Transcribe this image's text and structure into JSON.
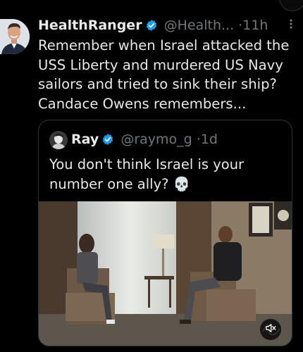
{
  "tweet": {
    "display_name": "HealthRanger",
    "handle": "@Health...",
    "separator": "·",
    "time": "11h",
    "more_icon": "more-vertical-icon",
    "text": "Remember when Israel attacked the\nUSS Liberty and murdered US Navy\nsailors and tried to sink their ship?\nCandace Owens remembers...",
    "verified_color": "#1d9bf0"
  },
  "quote": {
    "display_name": "Ray",
    "handle": "@raymo_g",
    "separator": "·",
    "time": "1d",
    "text": "You don't think Israel is your\nnumber one ally? 💀",
    "media": {
      "type": "video",
      "mute_icon": "speaker-muted-icon"
    }
  }
}
